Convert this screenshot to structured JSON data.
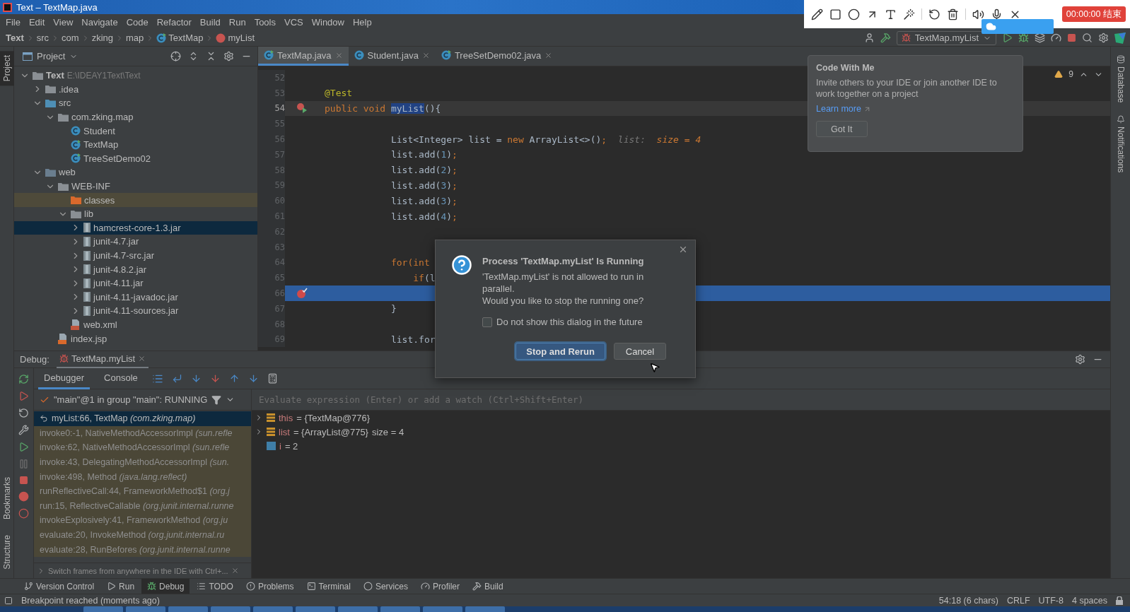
{
  "title_bar": {
    "title": "Text – TextMap.java"
  },
  "menu": [
    "File",
    "Edit",
    "View",
    "Navigate",
    "Code",
    "Refactor",
    "Build",
    "Run",
    "Tools",
    "VCS",
    "Window",
    "Help"
  ],
  "breadcrumbs": [
    {
      "label": "Text",
      "kind": "project"
    },
    {
      "label": "src",
      "kind": "folder"
    },
    {
      "label": "com",
      "kind": "folder"
    },
    {
      "label": "zking",
      "kind": "folder"
    },
    {
      "label": "map",
      "kind": "folder"
    },
    {
      "label": "TextMap",
      "kind": "class"
    },
    {
      "label": "myList",
      "kind": "method"
    }
  ],
  "toolbar": {
    "run_config": "TextMap.myList"
  },
  "recorder": {
    "timer": "00:00:00 结束"
  },
  "left_stripe": {
    "top": [
      {
        "label": "Project",
        "selected": true
      }
    ],
    "bottom": [
      {
        "label": "Bookmarks",
        "selected": false
      },
      {
        "label": "Structure",
        "selected": false
      }
    ]
  },
  "right_stripe": [
    {
      "label": "Database",
      "kind": "database"
    },
    {
      "label": "Notifications",
      "kind": "bell"
    }
  ],
  "project_panel": {
    "title": "Project",
    "tree": [
      {
        "label": "Text",
        "path": "E:\\IDEAY1Text\\Text",
        "kind": "module",
        "expanded": true,
        "selected": false,
        "children": [
          {
            "label": ".idea",
            "kind": "folder",
            "expanded": false,
            "selected": false
          },
          {
            "label": "src",
            "kind": "source_folder",
            "expanded": true,
            "selected": false,
            "children": [
              {
                "label": "com.zking.map",
                "kind": "package",
                "expanded": true,
                "selected": false,
                "children": [
                  {
                    "label": "Student",
                    "kind": "class",
                    "selected": false
                  },
                  {
                    "label": "TextMap",
                    "kind": "test_class",
                    "selected": false
                  },
                  {
                    "label": "TreeSetDemo02",
                    "kind": "test_class",
                    "selected": false
                  }
                ]
              }
            ]
          },
          {
            "label": "web",
            "kind": "web_folder",
            "expanded": true,
            "selected": false,
            "children": [
              {
                "label": "WEB-INF",
                "kind": "folder",
                "expanded": true,
                "selected": false,
                "children": [
                  {
                    "label": "classes",
                    "kind": "excluded_folder",
                    "selected": false
                  },
                  {
                    "label": "lib",
                    "kind": "folder",
                    "expanded": true,
                    "selected": false,
                    "children": [
                      {
                        "label": "hamcrest-core-1.3.jar",
                        "kind": "jar",
                        "expanded": false,
                        "selected": true
                      },
                      {
                        "label": "junit-4.7.jar",
                        "kind": "jar",
                        "expanded": false,
                        "selected": false
                      },
                      {
                        "label": "junit-4.7-src.jar",
                        "kind": "jar",
                        "expanded": false,
                        "selected": false
                      },
                      {
                        "label": "junit-4.8.2.jar",
                        "kind": "jar",
                        "expanded": false,
                        "selected": false
                      },
                      {
                        "label": "junit-4.11.jar",
                        "kind": "jar",
                        "expanded": false,
                        "selected": false
                      },
                      {
                        "label": "junit-4.11-javadoc.jar",
                        "kind": "jar",
                        "expanded": false,
                        "selected": false
                      },
                      {
                        "label": "junit-4.11-sources.jar",
                        "kind": "jar",
                        "expanded": false,
                        "selected": false
                      }
                    ]
                  },
                  {
                    "label": "web.xml",
                    "kind": "xml",
                    "selected": false
                  }
                ]
              },
              {
                "label": "index.jsp",
                "kind": "jsp",
                "selected": false
              }
            ]
          }
        ]
      }
    ]
  },
  "editor": {
    "tabs": [
      {
        "label": "TextMap.java",
        "kind": "test_class",
        "selected": true
      },
      {
        "label": "Student.java",
        "kind": "class",
        "selected": false
      },
      {
        "label": "TreeSetDemo02.java",
        "kind": "test_class",
        "selected": false
      }
    ],
    "warnings": "9",
    "lines": [
      {
        "number": "52",
        "caret_line": false,
        "execution_point": false
      },
      {
        "number": "53",
        "tokens": [
          {
            "text": "@Test",
            "kind": "annotation"
          }
        ],
        "caret_line": false,
        "execution_point": false
      },
      {
        "number": "54",
        "gutter": {
          "kind": "run_test"
        },
        "tokens": [
          {
            "text": "public void ",
            "kind": "keyword"
          },
          {
            "text": "myList",
            "kind": "selection"
          },
          {
            "text": "(){",
            "kind": "plain"
          }
        ],
        "caret_line": true,
        "execution_point": false
      },
      {
        "number": "55",
        "caret_line": false,
        "execution_point": false
      },
      {
        "number": "56",
        "tokens": [
          {
            "text": "            List<Integer> list = ",
            "kind": "plain"
          },
          {
            "text": "new",
            "kind": "keyword"
          },
          {
            "text": " ArrayList<>()",
            "kind": "plain"
          },
          {
            "text": ";",
            "kind": "keyword"
          },
          {
            "text": "  list:",
            "kind": "hint"
          },
          {
            "text": "  size = 4",
            "kind": "hint_value"
          }
        ],
        "caret_line": false,
        "execution_point": false
      },
      {
        "number": "57",
        "tokens": [
          {
            "text": "            list.add(",
            "kind": "plain"
          },
          {
            "text": "1",
            "kind": "number"
          },
          {
            "text": ")",
            "kind": "plain"
          },
          {
            "text": ";",
            "kind": "keyword"
          }
        ],
        "caret_line": false,
        "execution_point": false
      },
      {
        "number": "58",
        "tokens": [
          {
            "text": "            list.add(",
            "kind": "plain"
          },
          {
            "text": "2",
            "kind": "number"
          },
          {
            "text": ")",
            "kind": "plain"
          },
          {
            "text": ";",
            "kind": "keyword"
          }
        ],
        "caret_line": false,
        "execution_point": false
      },
      {
        "number": "59",
        "tokens": [
          {
            "text": "            list.add(",
            "kind": "plain"
          },
          {
            "text": "3",
            "kind": "number"
          },
          {
            "text": ")",
            "kind": "plain"
          },
          {
            "text": ";",
            "kind": "keyword"
          }
        ],
        "caret_line": false,
        "execution_point": false
      },
      {
        "number": "60",
        "tokens": [
          {
            "text": "            list.add(",
            "kind": "plain"
          },
          {
            "text": "3",
            "kind": "number"
          },
          {
            "text": ")",
            "kind": "plain"
          },
          {
            "text": ";",
            "kind": "keyword"
          }
        ],
        "caret_line": false,
        "execution_point": false
      },
      {
        "number": "61",
        "tokens": [
          {
            "text": "            list.add(",
            "kind": "plain"
          },
          {
            "text": "4",
            "kind": "number"
          },
          {
            "text": ")",
            "kind": "plain"
          },
          {
            "text": ";",
            "kind": "keyword"
          }
        ],
        "caret_line": false,
        "execution_point": false
      },
      {
        "number": "62",
        "caret_line": false,
        "execution_point": false
      },
      {
        "number": "63",
        "caret_line": false,
        "execution_point": false
      },
      {
        "number": "64",
        "tokens": [
          {
            "text": "            for(int",
            "kind": "keyword"
          }
        ],
        "caret_line": false,
        "execution_point": false
      },
      {
        "number": "65",
        "tokens": [
          {
            "text": "                if",
            "kind": "keyword"
          },
          {
            "text": "(l",
            "kind": "plain"
          }
        ],
        "caret_line": false,
        "execution_point": false
      },
      {
        "number": "66",
        "gutter": {
          "kind": "breakpoint_hit"
        },
        "caret_line": false,
        "execution_point": true
      },
      {
        "number": "67",
        "tokens": [
          {
            "text": "            }",
            "kind": "plain"
          }
        ],
        "caret_line": false,
        "execution_point": false
      },
      {
        "number": "68",
        "caret_line": false,
        "execution_point": false
      },
      {
        "number": "69",
        "tokens": [
          {
            "text": "            list.for",
            "kind": "plain"
          }
        ],
        "caret_line": false,
        "execution_point": false
      }
    ]
  },
  "dialog": {
    "title": "Process 'TextMap.myList' Is Running",
    "message": [
      "'TextMap.myList' is not allowed to run in parallel.",
      "Would you like to stop the running one?"
    ],
    "checkbox": {
      "label": "Do not show this dialog in the future",
      "checked": false
    },
    "buttons": [
      {
        "label": "Stop and Rerun",
        "default": true
      },
      {
        "label": "Cancel",
        "default": false
      }
    ]
  },
  "popup": {
    "title": "Code With Me",
    "body": "Invite others to your IDE or join another IDE to work together on a project",
    "link": "Learn more",
    "button": "Got It"
  },
  "debug": {
    "label": "Debug:",
    "session": "TextMap.myList",
    "tabs": [
      {
        "label": "Debugger",
        "selected": true
      },
      {
        "label": "Console",
        "selected": false
      }
    ],
    "thread": "\"main\"@1 in group \"main\": RUNNING",
    "frames": [
      {
        "location": "myList:66, TextMap",
        "package": "(com.zking.map)",
        "selected": true,
        "library": false
      },
      {
        "location": "invoke0:-1, NativeMethodAccessorImpl",
        "package": "(sun.refle",
        "selected": false,
        "library": true
      },
      {
        "location": "invoke:62, NativeMethodAccessorImpl",
        "package": "(sun.refle",
        "selected": false,
        "library": true
      },
      {
        "location": "invoke:43, DelegatingMethodAccessorImpl",
        "package": "(sun.",
        "selected": false,
        "library": true
      },
      {
        "location": "invoke:498, Method",
        "package": "(java.lang.reflect)",
        "selected": false,
        "library": true
      },
      {
        "location": "runReflectiveCall:44, FrameworkMethod$1",
        "package": "(org.j",
        "selected": false,
        "library": true
      },
      {
        "location": "run:15, ReflectiveCallable",
        "package": "(org.junit.internal.runne",
        "selected": false,
        "library": true
      },
      {
        "location": "invokeExplosively:41, FrameworkMethod",
        "package": "(org.ju",
        "selected": false,
        "library": true
      },
      {
        "location": "evaluate:20, InvokeMethod",
        "package": "(org.junit.internal.ru",
        "selected": false,
        "library": true
      },
      {
        "location": "evaluate:28, RunBefores",
        "package": "(org.junit.internal.runne",
        "selected": false,
        "library": true
      }
    ],
    "hint": "Switch frames from anywhere in the IDE with Ctrl+...",
    "watch_placeholder": "Evaluate expression (Enter) or add a watch (Ctrl+Shift+Enter)",
    "variables": [
      {
        "name": "this",
        "value": "= {TextMap@776}",
        "kind": "object",
        "expanded": false
      },
      {
        "name": "list",
        "value": "= {ArrayList@775}",
        "extra": "size = 4",
        "kind": "object",
        "expanded": false
      },
      {
        "name": "i",
        "value": "= 2",
        "kind": "primitive"
      }
    ]
  },
  "tool_windows": [
    {
      "label": "Version Control",
      "kind": "vcs",
      "selected": false
    },
    {
      "label": "Run",
      "kind": "run",
      "selected": false
    },
    {
      "label": "Debug",
      "kind": "debug",
      "selected": true
    },
    {
      "label": "TODO",
      "kind": "todo",
      "selected": false
    },
    {
      "label": "Problems",
      "kind": "problems",
      "selected": false
    },
    {
      "label": "Terminal",
      "kind": "terminal",
      "selected": false
    },
    {
      "label": "Services",
      "kind": "services",
      "selected": false
    },
    {
      "label": "Profiler",
      "kind": "profiler",
      "selected": false
    },
    {
      "label": "Build",
      "kind": "build",
      "selected": false
    }
  ],
  "status_bar": {
    "message": "Breakpoint reached (moments ago)",
    "position": "54:18 (6 chars)",
    "line_ending": "CRLF",
    "encoding": "UTF-8",
    "indent": "4 spaces"
  }
}
